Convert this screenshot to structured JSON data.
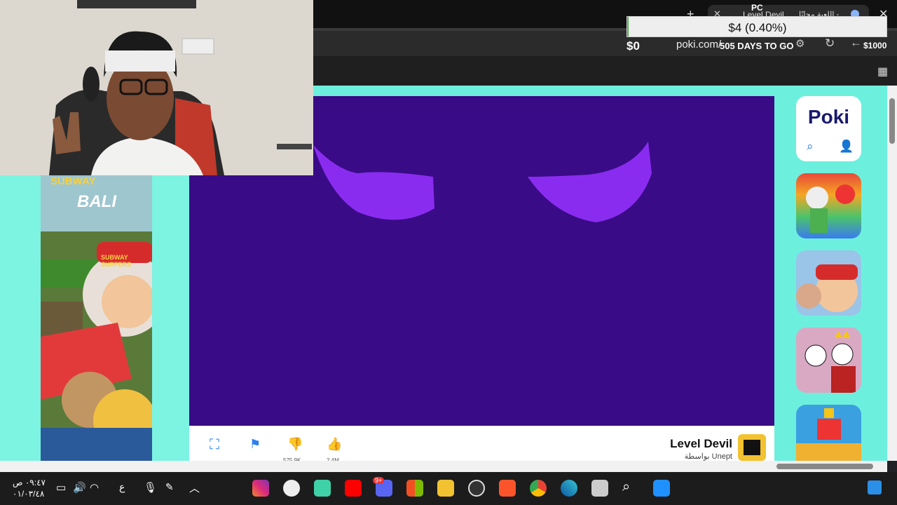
{
  "browser": {
    "tab_label": "Level Devil",
    "tab_label_rtl": "اللعبة مجانًا -",
    "address": "poki.com/",
    "new_tab": "+"
  },
  "stream_overlay": {
    "donation_goal": "$4 (0.40%)",
    "goal_min": "$0",
    "goal_max": "$1000",
    "days_to_go": "505 DAYS TO GO",
    "pc_label": "PC"
  },
  "poki": {
    "logo": "Poki"
  },
  "game": {
    "title": "Level Devil",
    "byline": "بواسطة Unept",
    "dislikes": "575.9K",
    "likes": "2.4M"
  },
  "ad": {
    "brand1": "SUBWAY",
    "brand2": "BALI",
    "brand3": "SUBWAY SURFERS"
  },
  "taskbar": {
    "time": "٠٩:٤٧ ص",
    "date": "٠١/٠٣/٤٨",
    "lang": "ع",
    "discord_badge": "9+"
  },
  "colors": {
    "game_bg": "#3a0b86",
    "eyes": "#8a2cf0",
    "poki_bg": "#6cf0dd",
    "accent": "#2f80ed"
  }
}
